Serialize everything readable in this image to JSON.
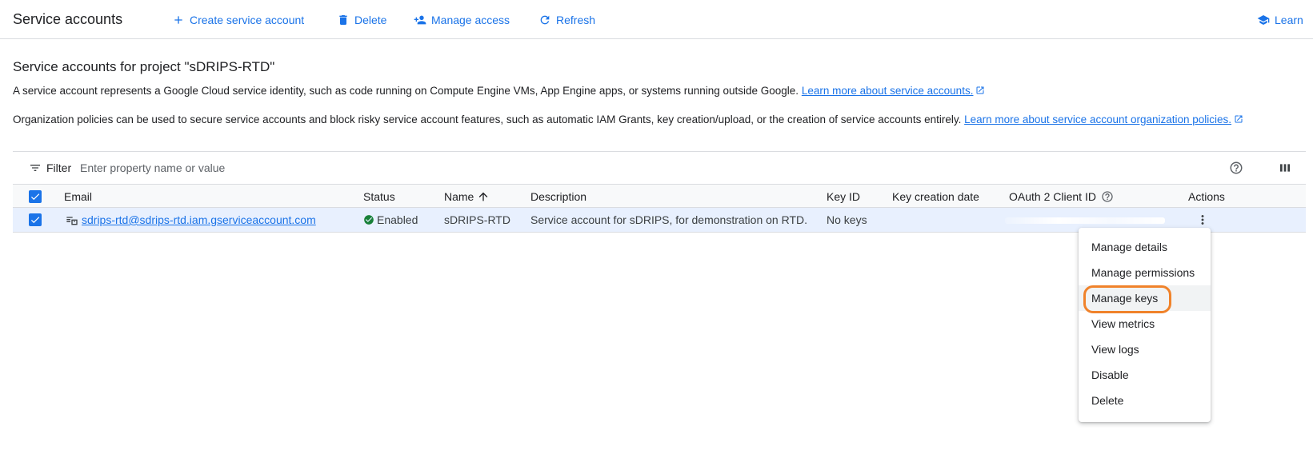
{
  "header": {
    "title": "Service accounts",
    "actions": {
      "create": "Create service account",
      "delete": "Delete",
      "manage_access": "Manage access",
      "refresh": "Refresh",
      "learn": "Learn"
    }
  },
  "main": {
    "heading": "Service accounts for project \"sDRIPS-RTD\"",
    "description_1": "A service account represents a Google Cloud service identity, such as code running on Compute Engine VMs, App Engine apps, or systems running outside Google.",
    "link_1": "Learn more about service accounts.",
    "description_2": "Organization policies can be used to secure service accounts and block risky service account features, such as automatic IAM Grants, key creation/upload, or the creation of service accounts entirely.",
    "link_2": "Learn more about service account organization policies."
  },
  "filter": {
    "label": "Filter",
    "placeholder": "Enter property name or value"
  },
  "table": {
    "headers": {
      "email": "Email",
      "status": "Status",
      "name": "Name",
      "description": "Description",
      "key_id": "Key ID",
      "key_creation_date": "Key creation date",
      "oauth_client_id": "OAuth 2 Client ID",
      "actions": "Actions"
    },
    "rows": [
      {
        "email": "sdrips-rtd@sdrips-rtd.iam.gserviceaccount.com",
        "status": "Enabled",
        "name": "sDRIPS-RTD",
        "description": "Service account for sDRIPS, for demonstration on RTD.",
        "key_id": "No keys",
        "key_creation_date": "",
        "oauth_client_id": ""
      }
    ]
  },
  "actions_menu": {
    "items": [
      "Manage details",
      "Manage permissions",
      "Manage keys",
      "View metrics",
      "View logs",
      "Disable",
      "Delete"
    ],
    "highlighted": "Manage keys"
  },
  "colors": {
    "accent": "#1a73e8",
    "status_ok": "#188038",
    "annotation": "#f0822a",
    "row_selected": "#e8f0fe"
  }
}
